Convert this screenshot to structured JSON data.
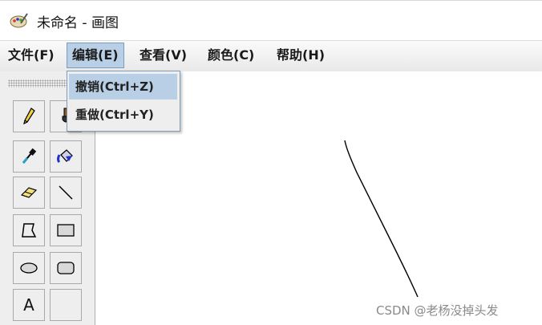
{
  "window": {
    "title": "未命名 - 画图",
    "icon": "paint-palette-icon"
  },
  "menubar": {
    "items": [
      {
        "label": "文件(F)"
      },
      {
        "label": "编辑(E)",
        "active": true
      },
      {
        "label": "查看(V)"
      },
      {
        "label": "颜色(C)"
      },
      {
        "label": "帮助(H)"
      }
    ]
  },
  "edit_menu": {
    "items": [
      {
        "label": "撤销(Ctrl+Z)",
        "highlighted": true
      },
      {
        "label": "重做(Ctrl+Y)"
      }
    ]
  },
  "toolbox": {
    "tools": [
      {
        "icon": "pencil-icon"
      },
      {
        "icon": "brush-icon"
      },
      {
        "icon": "color-picker-icon"
      },
      {
        "icon": "fill-bucket-icon"
      },
      {
        "icon": "eraser-icon"
      },
      {
        "icon": "line-icon"
      },
      {
        "icon": "polygon-icon"
      },
      {
        "icon": "rectangle-icon"
      },
      {
        "icon": "ellipse-icon"
      },
      {
        "icon": "rounded-rectangle-icon"
      },
      {
        "text": "A",
        "icon": "text-tool-icon"
      },
      {
        "icon": "empty-slot"
      }
    ]
  },
  "watermark": "CSDN @老杨没掉头发",
  "colors": {
    "menu_highlight": "#b8cfe5",
    "menu_border": "#7a9cc0",
    "toolbox_bg": "#eeeeee",
    "canvas_bg": "#ffffff"
  }
}
